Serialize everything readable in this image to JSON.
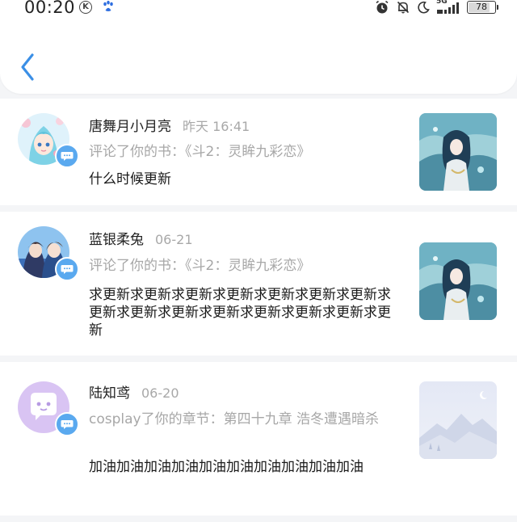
{
  "status_bar": {
    "time": "00:20",
    "k_icon": "K",
    "network": "5G",
    "battery": "78"
  },
  "header": {
    "back_icon": "chevron-left-icon"
  },
  "notifications": [
    {
      "name": "唐舞月小月亮",
      "time": "昨天 16:41",
      "action": "评论了你的书：《斗2：灵眸九彩恋》",
      "content": "什么时候更新"
    },
    {
      "name": "蓝银柔兔",
      "time": "06-21",
      "action": "评论了你的书：《斗2：灵眸九彩恋》",
      "content": "求更新求更新求更新求更新求更新求更新求更新求更新求更新求更新求更新求更新求更新求更新求更新"
    },
    {
      "name": "陆知鸢",
      "time": "06-20",
      "action": "cosplay了你的章节：第四十九章 浩冬遭遇暗杀",
      "content": "加油加油加油加油加油加油加油加油加油加油"
    }
  ],
  "colors": {
    "accent": "#3b8fe6",
    "badge": "#5aa9ef",
    "secondary_text": "#a7a7a7"
  }
}
